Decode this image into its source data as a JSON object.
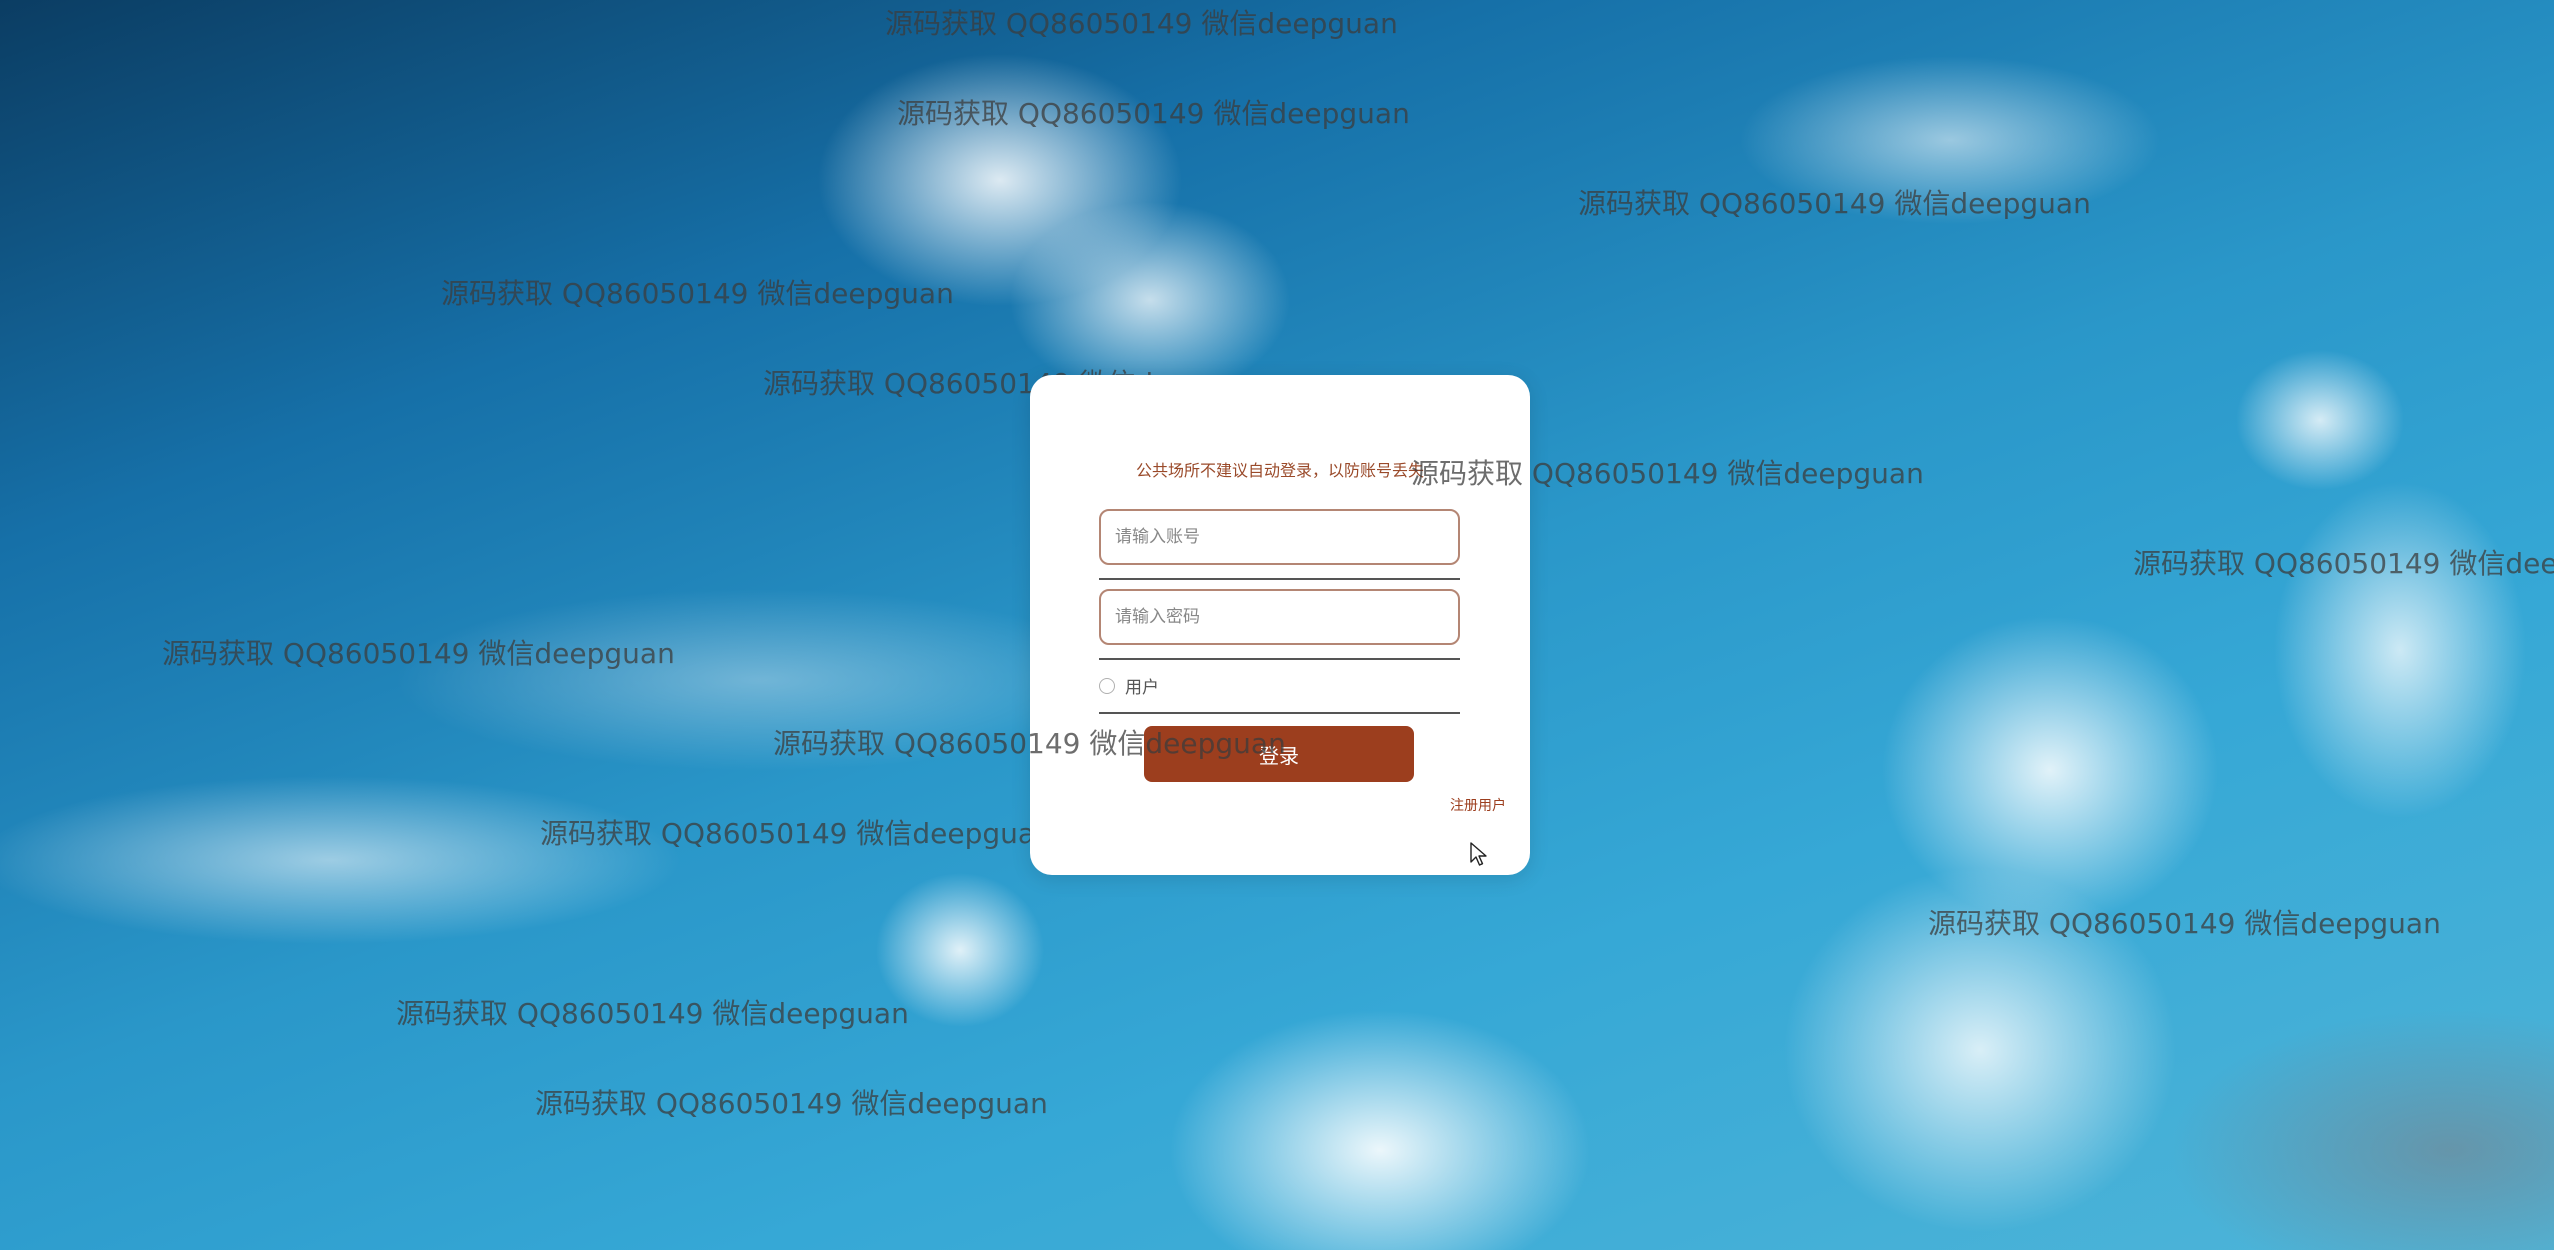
{
  "background": {
    "description_colors": [
      "#0b3d63",
      "#1670a8",
      "#36a8d6",
      "#ffffff"
    ]
  },
  "watermark": {
    "text": "源码获取 QQ86050149 微信deepguan"
  },
  "login": {
    "tip": "公共场所不建议自动登录，以防账号丢失",
    "username_placeholder": "请输入账号",
    "password_placeholder": "请输入密码",
    "role_label": "用户",
    "login_button": "登录",
    "register_link": "注册用户"
  },
  "colors": {
    "accent": "#9c3e1e",
    "input_border": "#b48674"
  },
  "icons": {
    "cursor": "mouse-pointer-icon",
    "radio": "radio-unchecked-icon"
  }
}
